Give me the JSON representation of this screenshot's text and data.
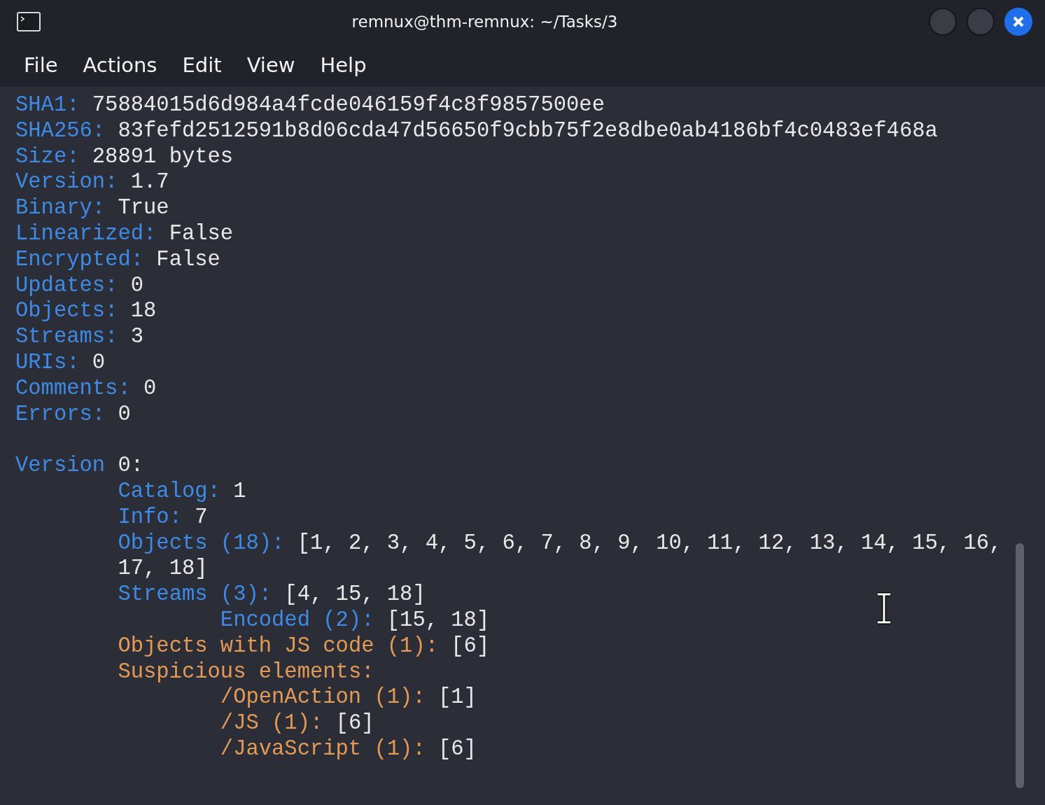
{
  "window": {
    "title": "remnux@thm-remnux: ~/Tasks/3"
  },
  "menu": [
    "File",
    "Actions",
    "Edit",
    "View",
    "Help"
  ],
  "lines": [
    {
      "key": "SHA1:",
      "value": "75884015d6d984a4fcde046159f4c8f9857500ee",
      "color": "#3d8be6"
    },
    {
      "key": "SHA256:",
      "value": "83fefd2512591b8d06cda47d56650f9cbb75f2e8dbe0ab4186bf4c0483ef468a",
      "color": "#3d8be6"
    },
    {
      "key": "Size:",
      "value": "28891 bytes",
      "color": "#3d8be6"
    },
    {
      "key": "Version:",
      "value": "1.7",
      "color": "#3d8be6"
    },
    {
      "key": "Binary:",
      "value": "True",
      "color": "#3d8be6"
    },
    {
      "key": "Linearized:",
      "value": "False",
      "color": "#3d8be6"
    },
    {
      "key": "Encrypted:",
      "value": "False",
      "color": "#3d8be6"
    },
    {
      "key": "Updates:",
      "value": "0",
      "color": "#3d8be6"
    },
    {
      "key": "Objects:",
      "value": "18",
      "color": "#3d8be6"
    },
    {
      "key": "Streams:",
      "value": "3",
      "color": "#3d8be6"
    },
    {
      "key": "URIs:",
      "value": "0",
      "color": "#3d8be6"
    },
    {
      "key": "Comments:",
      "value": "0",
      "color": "#3d8be6"
    },
    {
      "key": "Errors:",
      "value": "0",
      "color": "#3d8be6"
    },
    {
      "kind": "blank"
    },
    {
      "key": "Version",
      "value": "0:",
      "color": "#3d8be6",
      "children": [
        {
          "key": "Catalog:",
          "value": "1",
          "color": "#3d8be6"
        },
        {
          "key": "Info:",
          "value": "7",
          "color": "#3d8be6"
        },
        {
          "key": "Objects (18):",
          "value": "[1, 2, 3, 4, 5, 6, 7, 8, 9, 10, 11, 12, 13, 14, 15, 16, 17, 18]",
          "color": "#3d8be6"
        },
        {
          "key": "Streams (3):",
          "value": "[4, 15, 18]",
          "color": "#3d8be6",
          "children": [
            {
              "key": "Encoded (2):",
              "value": "[15, 18]",
              "color": "#3d8be6"
            }
          ]
        },
        {
          "key": "Objects with JS code (1):",
          "value": "[6]",
          "color": "#e39a55"
        },
        {
          "key": "Suspicious elements:",
          "color": "#e39a55",
          "children": [
            {
              "key": "/OpenAction (1):",
              "value": "[1]",
              "color": "#e39a55"
            },
            {
              "key": "/JS (1):",
              "value": "[6]",
              "color": "#e39a55"
            },
            {
              "key": "/JavaScript (1):",
              "value": "[6]",
              "color": "#e39a55"
            }
          ]
        }
      ]
    }
  ]
}
